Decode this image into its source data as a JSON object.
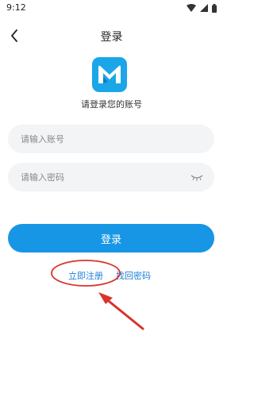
{
  "status_bar": {
    "time": "9:12"
  },
  "header": {
    "title": "登录"
  },
  "logo": {
    "letter": "M",
    "color": "#1aa6e8"
  },
  "subtitle": "请登录您的账号",
  "form": {
    "account_placeholder": "请输入账号",
    "password_placeholder": "请输入密码"
  },
  "buttons": {
    "login_label": "登录"
  },
  "links": {
    "register_label": "立即注册",
    "forgot_label": "找回密码"
  },
  "colors": {
    "accent": "#1796e6",
    "link": "#1f7fd8",
    "annotation": "#d9342b"
  }
}
